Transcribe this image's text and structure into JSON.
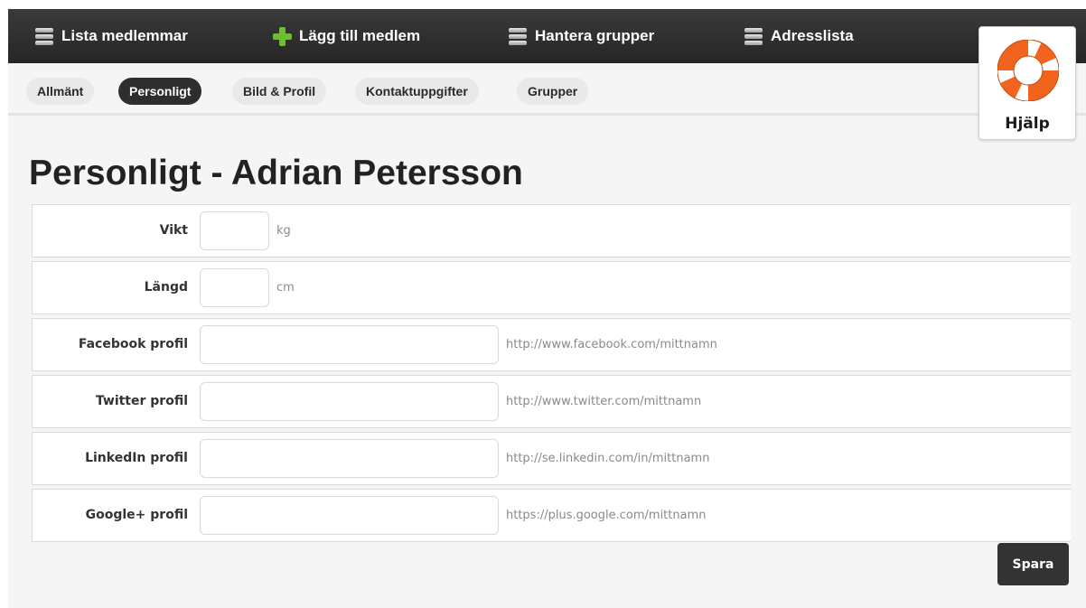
{
  "topnav": {
    "items": [
      {
        "label": "Lista medlemmar",
        "icon": "list-stack-icon"
      },
      {
        "label": "Lägg till medlem",
        "icon": "plus-icon"
      },
      {
        "label": "Hantera grupper",
        "icon": "list-stack-icon"
      },
      {
        "label": "Adresslista",
        "icon": "list-stack-icon"
      }
    ]
  },
  "subnav": {
    "tabs": [
      {
        "label": "Allmänt",
        "active": false
      },
      {
        "label": "Personligt",
        "active": true
      },
      {
        "label": "Bild & Profil",
        "active": false
      },
      {
        "label": "Kontaktuppgifter",
        "active": false
      },
      {
        "label": "Grupper",
        "active": false
      }
    ]
  },
  "help": {
    "label": "Hjälp",
    "icon": "lifebuoy-icon"
  },
  "page": {
    "title": "Personligt - Adrian Petersson"
  },
  "form": {
    "fields": [
      {
        "label": "Vikt",
        "value": "",
        "hint": "kg"
      },
      {
        "label": "Längd",
        "value": "",
        "hint": "cm"
      },
      {
        "label": "Facebook profil",
        "value": "",
        "hint": "http://www.facebook.com/mittnamn"
      },
      {
        "label": "Twitter profil",
        "value": "",
        "hint": "http://www.twitter.com/mittnamn"
      },
      {
        "label": "LinkedIn profil",
        "value": "",
        "hint": "http://se.linkedin.com/in/mittnamn"
      },
      {
        "label": "Google+ profil",
        "value": "",
        "hint": "https://plus.google.com/mittnamn"
      }
    ],
    "save_label": "Spara"
  },
  "colors": {
    "nav_bg": "#2e2e2e",
    "active_tab_bg": "#2e2e2e",
    "tab_bg": "#e9e9e9",
    "plus_green": "#6cc02a",
    "lifebuoy_orange": "#f0641e",
    "page_bg": "#f5f5f5"
  }
}
